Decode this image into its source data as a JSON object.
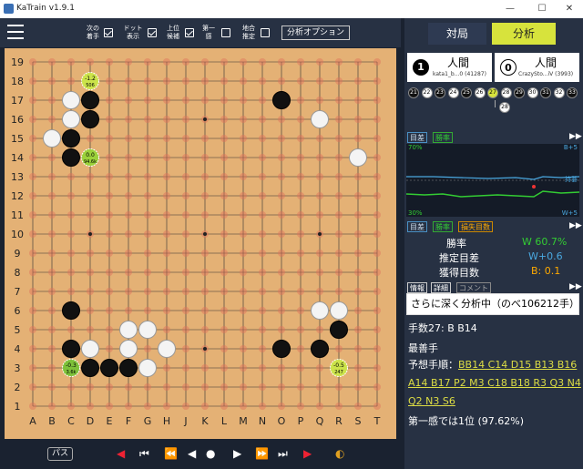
{
  "window": {
    "title": "KaTrain v1.9.1",
    "minimize": "—",
    "maximize": "☐",
    "close": "✕"
  },
  "topbar": {
    "opt1": "次の\n着手",
    "opt2": "ドット\n表示",
    "opt3": "上位\n候補",
    "opt4": "第一\n感",
    "opt5": "地合\n推定",
    "analysis_options": "分析オプション",
    "checks": [
      true,
      true,
      true,
      false,
      false
    ]
  },
  "tabs": {
    "play": "対局",
    "analysis": "分析"
  },
  "players": {
    "black": {
      "captures": "1",
      "type": "人間",
      "name": "kata1_b...0 (41287)"
    },
    "white": {
      "captures": "0",
      "type": "人間",
      "name": "CrazySto...iV (3993)"
    }
  },
  "moves": [
    "21",
    "22",
    "23",
    "24",
    "25",
    "26",
    "27",
    "28",
    "29",
    "30",
    "31",
    "32",
    "33"
  ],
  "current_move_below": "28",
  "graph_tabs": {
    "score": "目差",
    "winrate": "勝率",
    "points_lost": "損失目数"
  },
  "graph_labels": {
    "top_left": "70%",
    "top_right": "B+5",
    "bottom_left": "30%",
    "bottom_right": "W+5",
    "mid_right": "持碁"
  },
  "stats": {
    "winrate_label": "勝率",
    "winrate_value": "W 60.7%",
    "score_label": "推定目差",
    "score_value": "W+0.6",
    "points_label": "獲得目数",
    "points_value": "B: 0.1"
  },
  "info_tabs": {
    "info": "情報",
    "detail": "詳細",
    "comment": "コメント"
  },
  "analysis_button": "さらに深く分析中（のべ106212手）",
  "info": {
    "move": "手数27: B B14",
    "best": "最善手",
    "pv_label": "予想手順：",
    "pv_line1": "BB14 C14 D15 B13 B16",
    "pv_line2": "A14 B17 P2 M3 C18 B18 R3 Q3 N4",
    "pv_line3": "Q2 N3 S6",
    "policy": "第一感では1位 (97.62%)"
  },
  "bottom": {
    "pass": "パス"
  },
  "board": {
    "cols": [
      "A",
      "B",
      "C",
      "D",
      "E",
      "F",
      "G",
      "H",
      "J",
      "K",
      "L",
      "M",
      "N",
      "O",
      "P",
      "Q",
      "R",
      "S",
      "T"
    ],
    "rows": [
      "19",
      "18",
      "17",
      "16",
      "15",
      "14",
      "13",
      "12",
      "11",
      "10",
      "9",
      "8",
      "7",
      "6",
      "5",
      "4",
      "3",
      "2",
      "1"
    ],
    "black": [
      [
        "D",
        17
      ],
      [
        "D",
        16
      ],
      [
        "C",
        15
      ],
      [
        "C",
        14
      ],
      [
        "O",
        17
      ],
      [
        "R",
        5
      ],
      [
        "Q",
        4
      ],
      [
        "O",
        4
      ],
      [
        "C",
        4
      ],
      [
        "C",
        6
      ],
      [
        "D",
        3
      ],
      [
        "E",
        3
      ],
      [
        "F",
        3
      ]
    ],
    "white": [
      [
        "C",
        17
      ],
      [
        "C",
        16
      ],
      [
        "B",
        15
      ],
      [
        "S",
        14
      ],
      [
        "Q",
        16
      ],
      [
        "Q",
        6
      ],
      [
        "R",
        6
      ],
      [
        "F",
        5
      ],
      [
        "G",
        5
      ],
      [
        "F",
        4
      ],
      [
        "H",
        4
      ],
      [
        "D",
        4
      ],
      [
        "G",
        3
      ]
    ],
    "hints": [
      {
        "col": "D",
        "row": 18,
        "top": "-1.2",
        "bottom": "506",
        "color": "#cbe34a"
      },
      {
        "col": "D",
        "row": 14,
        "top": "0.0",
        "bottom": "94.6k",
        "color": "#9bd13a"
      },
      {
        "col": "C",
        "row": 3,
        "top": "-0.3",
        "bottom": "3.6k",
        "color": "#7ec13a"
      },
      {
        "col": "R",
        "row": 3,
        "top": "-0.5",
        "bottom": "247",
        "color": "#cbe34a"
      }
    ]
  }
}
